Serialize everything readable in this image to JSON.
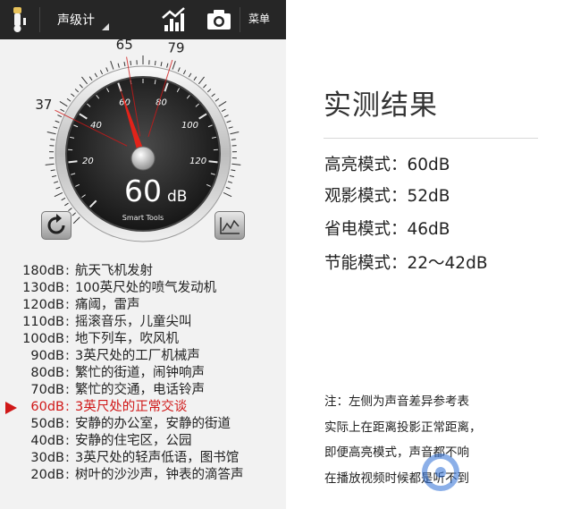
{
  "app": {
    "title": "声级计",
    "menu_label": "菜单"
  },
  "meter": {
    "reading_value": "60",
    "reading_unit": "dB",
    "brand": "Smart Tools",
    "dial_ticks": [
      "20",
      "40",
      "60",
      "80",
      "100",
      "120"
    ],
    "outer_marks": [
      "37",
      "65",
      "79"
    ],
    "needle_value": 60
  },
  "reference": [
    {
      "db": "180dB",
      "desc": "航天飞机发射"
    },
    {
      "db": "130dB",
      "desc": "100英尺处的喷气发动机"
    },
    {
      "db": "120dB",
      "desc": "痛阈，雷声"
    },
    {
      "db": "110dB",
      "desc": "摇滚音乐，儿童尖叫"
    },
    {
      "db": "100dB",
      "desc": "地下列车，吹风机"
    },
    {
      "db": "90dB",
      "desc": "3英尺处的工厂机械声"
    },
    {
      "db": "80dB",
      "desc": "繁忙的街道，闹钟响声"
    },
    {
      "db": "70dB",
      "desc": "繁忙的交通，电话铃声"
    },
    {
      "db": "60dB",
      "desc": "3英尺处的正常交谈",
      "current": true
    },
    {
      "db": "50dB",
      "desc": "安静的办公室，安静的街道"
    },
    {
      "db": "40dB",
      "desc": "安静的住宅区，公园"
    },
    {
      "db": "30dB",
      "desc": "3英尺处的轻声低语，图书馆"
    },
    {
      "db": "20dB",
      "desc": "树叶的沙沙声，钟表的滴答声"
    }
  ],
  "results": {
    "title": "实测结果",
    "modes": [
      "高亮模式：60dB",
      "观影模式：52dB",
      "省电模式：46dB",
      "节能模式：22～42dB"
    ],
    "note": [
      "注：左侧为声音差异参考表",
      "实际上在距离投影正常距离，",
      "即便高亮模式，声音都不响",
      "在播放视频时候都是听不到"
    ]
  },
  "colors": {
    "accent_red": "#d01818",
    "bar_bg": "#262626"
  }
}
